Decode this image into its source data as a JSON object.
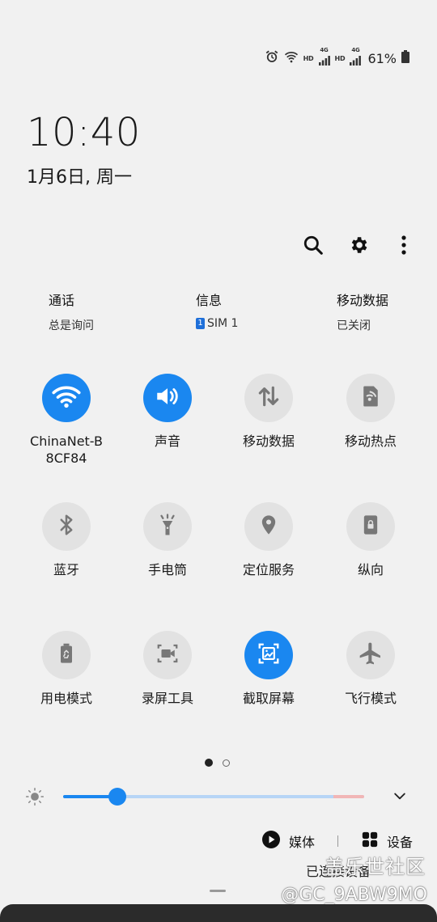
{
  "status_bar": {
    "hd1": "HD",
    "net1": "4G",
    "hd2": "HD",
    "net2": "4G",
    "battery": "61%"
  },
  "lock": {
    "time": "10:40",
    "date": "1月6日, 周一"
  },
  "sim": [
    {
      "title": "通话",
      "sub": "总是询问"
    },
    {
      "title": "信息",
      "sub": "SIM 1",
      "badge": "1"
    },
    {
      "title": "移动数据",
      "sub": "已关闭"
    }
  ],
  "tiles": [
    {
      "label": "ChinaNet-B\n8CF84",
      "icon": "wifi-icon",
      "on": true
    },
    {
      "label": "声音",
      "icon": "sound-icon",
      "on": true
    },
    {
      "label": "移动数据",
      "icon": "mobile-data-icon",
      "on": false
    },
    {
      "label": "移动热点",
      "icon": "hotspot-icon",
      "on": false
    },
    {
      "label": "蓝牙",
      "icon": "bluetooth-icon",
      "on": false
    },
    {
      "label": "手电筒",
      "icon": "flashlight-icon",
      "on": false
    },
    {
      "label": "定位服务",
      "icon": "location-icon",
      "on": false
    },
    {
      "label": "纵向",
      "icon": "portrait-lock-icon",
      "on": false
    },
    {
      "label": "用电模式",
      "icon": "power-mode-icon",
      "on": false
    },
    {
      "label": "录屏工具",
      "icon": "screen-record-icon",
      "on": false
    },
    {
      "label": "截取屏幕",
      "icon": "screenshot-icon",
      "on": true
    },
    {
      "label": "飞行模式",
      "icon": "airplane-icon",
      "on": false
    }
  ],
  "brightness": {
    "level": 0.18
  },
  "media": {
    "media_label": "媒体",
    "devices_label": "设备"
  },
  "bottom": {
    "partial_text": "已连接设备",
    "watermark": "盖乐世社区",
    "user_id": "@GC_9ABW9MO"
  },
  "colors": {
    "accent": "#1a87f0",
    "tile_off": "#e2e2e2",
    "background": "#f1f1f1"
  }
}
